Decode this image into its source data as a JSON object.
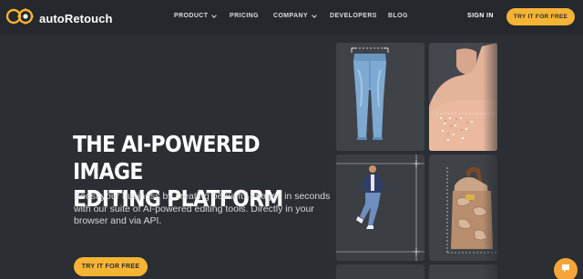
{
  "brand": {
    "name": "autoRetouch",
    "accent": "#f6b434",
    "logo_color": "#f6b434"
  },
  "nav": {
    "items": [
      {
        "label": "PRODUCT",
        "dropdown": true
      },
      {
        "label": "PRICING",
        "dropdown": false
      },
      {
        "label": "COMPANY",
        "dropdown": true
      },
      {
        "label": "DEVELOPERS",
        "dropdown": false
      },
      {
        "label": "BLOG",
        "dropdown": false
      }
    ],
    "signin": "SIGN IN",
    "cta": "TRY IT FOR FREE"
  },
  "hero": {
    "title_line1": "THE AI-POWERED IMAGE",
    "title_line2": "EDITING PLATFORM",
    "description": "Boost your business by creating beautiful images in seconds with our suite of AI-powered editing tools. Directly in your browser and via API.",
    "cta": "TRY IT FOR FREE"
  },
  "gallery": {
    "tiles": [
      {
        "subject": "jeans"
      },
      {
        "subject": "skin-retouch"
      },
      {
        "subject": "jumping-man"
      },
      {
        "subject": "handbag"
      }
    ]
  },
  "chat": {
    "icon": "chat-icon"
  },
  "colors": {
    "background": "#2b2e33",
    "nav_background": "#25282c",
    "tile": "#3f4247"
  }
}
